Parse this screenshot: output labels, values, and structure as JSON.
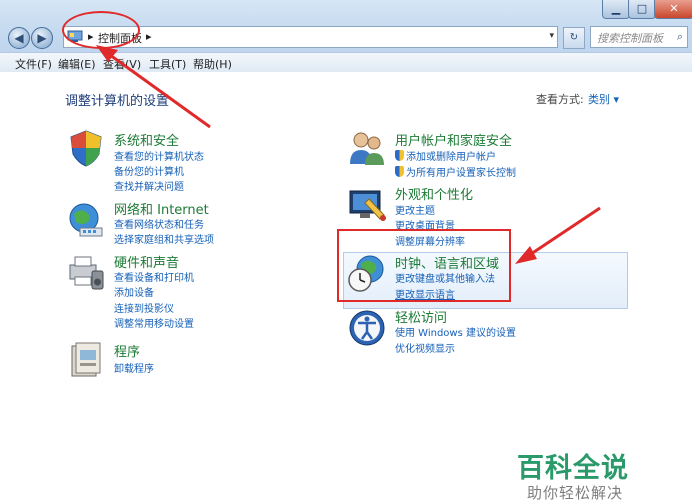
{
  "window": {
    "minimize_glyph": "▁",
    "maximize_glyph": "□",
    "close_glyph": "✕"
  },
  "nav": {
    "back_glyph": "◀",
    "forward_glyph": "▶",
    "address_separator": "▸",
    "breadcrumb": "控制面板",
    "breadcrumb_arrow": "▸",
    "dropdown_glyph": "▾",
    "refresh_glyph": "↻"
  },
  "search": {
    "placeholder": "搜索控制面板",
    "icon": "search-icon",
    "glyph": "⌕"
  },
  "menu": [
    "文件(F)",
    "编辑(E)",
    "查看(V)",
    "工具(T)",
    "帮助(H)"
  ],
  "page": {
    "heading": "调整计算机的设置",
    "view_by_label": "查看方式:",
    "view_by_value": "类别 ▾"
  },
  "left_categories": [
    {
      "title": "系统和安全",
      "icon": "shield-security-icon",
      "links": [
        "查看您的计算机状态",
        "备份您的计算机",
        "查找并解决问题"
      ]
    },
    {
      "title": "网络和 Internet",
      "icon": "network-globe-icon",
      "links": [
        "查看网络状态和任务",
        "选择家庭组和共享选项"
      ]
    },
    {
      "title": "硬件和声音",
      "icon": "printer-speaker-icon",
      "links": [
        "查看设备和打印机",
        "添加设备",
        "连接到投影仪",
        "调整常用移动设置"
      ]
    },
    {
      "title": "程序",
      "icon": "programs-box-icon",
      "links": [
        "卸载程序"
      ]
    }
  ],
  "right_categories": [
    {
      "title": "用户帐户和家庭安全",
      "icon": "users-icon",
      "links": [
        "添加或删除用户帐户",
        "为所有用户设置家长控制"
      ]
    },
    {
      "title": "外观和个性化",
      "icon": "appearance-monitor-icon",
      "links": [
        "更改主题",
        "更改桌面背景",
        "调整屏幕分辨率"
      ]
    },
    {
      "title": "时钟、语言和区域",
      "icon": "clock-globe-icon",
      "links": [
        "更改键盘或其他输入法",
        "更改显示语言"
      ]
    },
    {
      "title": "轻松访问",
      "icon": "ease-of-access-icon",
      "links": [
        "使用 Windows 建议的设置",
        "优化视频显示"
      ]
    }
  ],
  "watermark": {
    "main": "百科全说",
    "sub": "助你轻松解决"
  },
  "colors": {
    "category_title": "#1c7b35",
    "link": "#1660b8",
    "annotation_red": "#e02a2a",
    "watermark_green": "#2a9a6a"
  }
}
